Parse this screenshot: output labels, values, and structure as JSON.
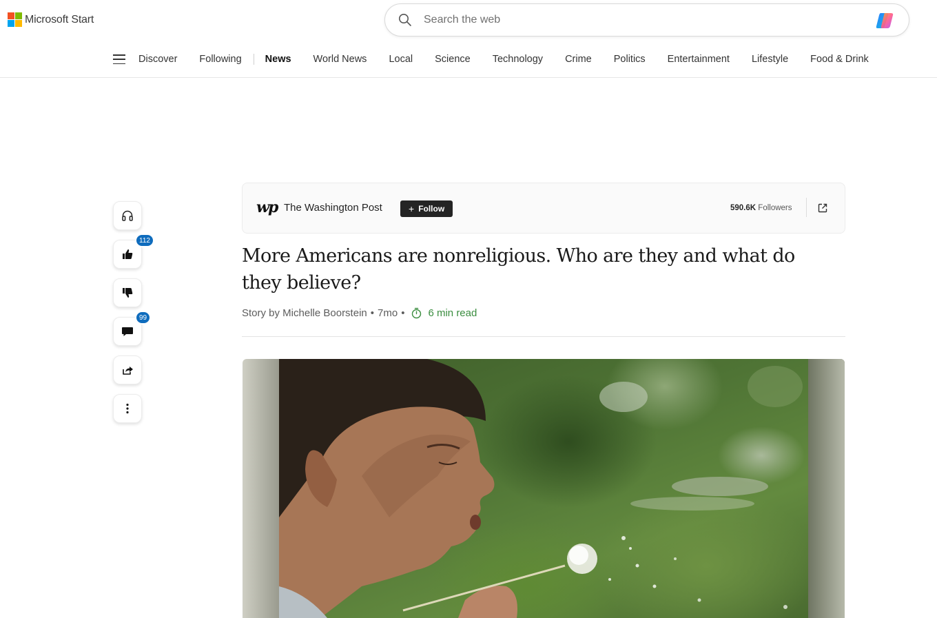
{
  "brand": {
    "name": "Microsoft Start",
    "logo_colors": [
      "#f25022",
      "#7fba00",
      "#00a4ef",
      "#ffb900"
    ]
  },
  "search": {
    "placeholder": "Search the web"
  },
  "nav": {
    "items": [
      "Discover",
      "Following",
      "News",
      "World News",
      "Local",
      "Science",
      "Technology",
      "Crime",
      "Politics",
      "Entertainment",
      "Lifestyle",
      "Food & Drink"
    ],
    "active": "News"
  },
  "rail": {
    "like_count": "112",
    "comment_count": "99",
    "badge_color": "#0f6cbd"
  },
  "publisher": {
    "logo_text": "wp",
    "name": "The Washington Post",
    "follow_label": "Follow",
    "followers_count": "590.6K",
    "followers_label": "Followers"
  },
  "article": {
    "headline": "More Americans are nonreligious. Who are they and what do they believe?",
    "byline": "Story by Michelle Boorstein",
    "age": "7mo",
    "read_time": "6 min read",
    "read_time_color": "#3a8d3f"
  }
}
